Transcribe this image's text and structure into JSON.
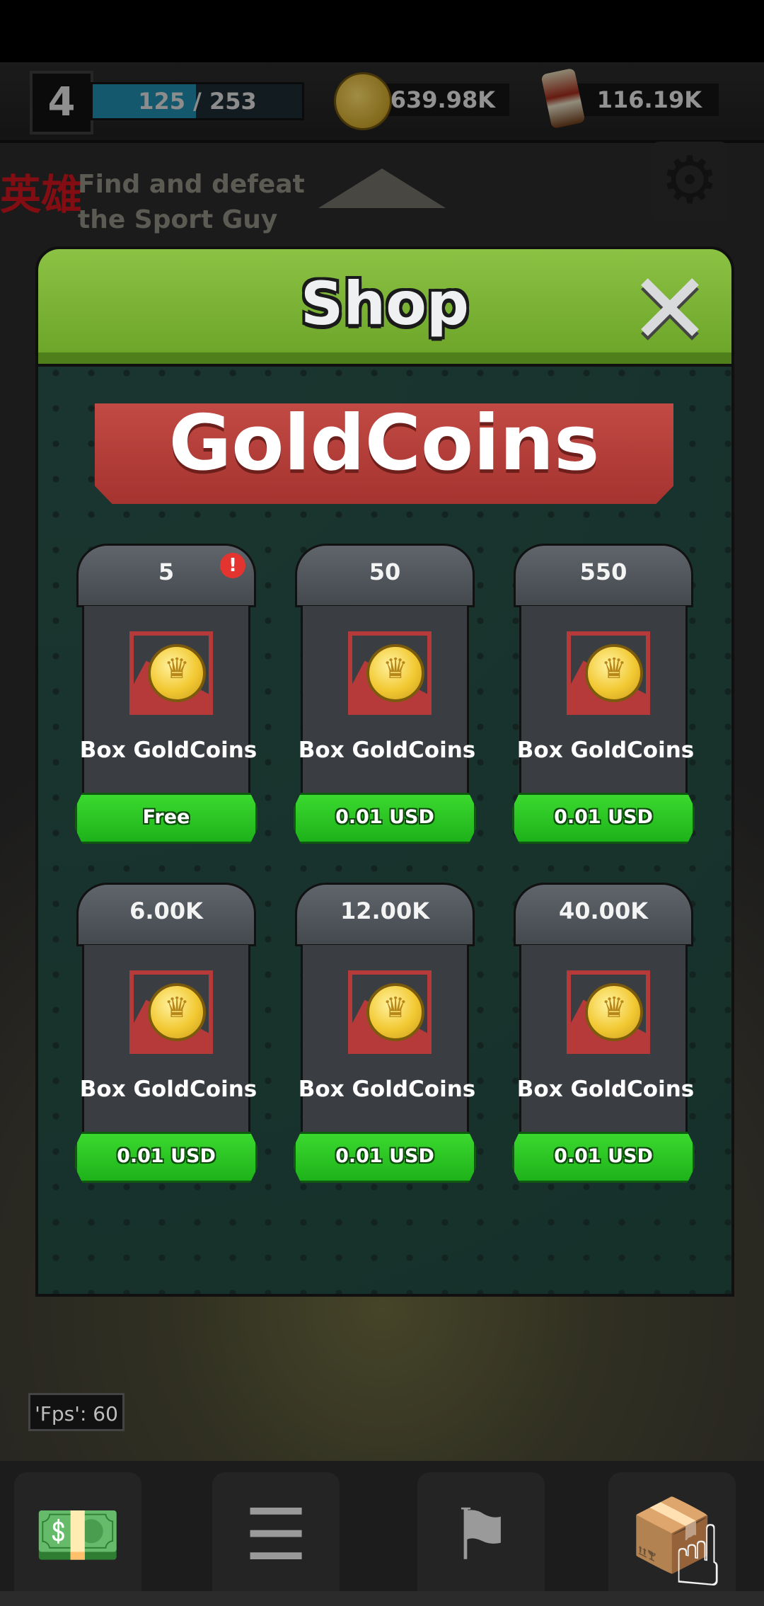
{
  "hud": {
    "level": "4",
    "xp_text": "125 / 253",
    "xp_progress": 0.494,
    "coins": "639.98K",
    "cans": "116.19K"
  },
  "quest": {
    "badge": "英雄",
    "text": "Find and defeat the Sport Guy"
  },
  "shop": {
    "title": "Shop",
    "close_symbol": "✕",
    "banner": "GoldCoins",
    "items": [
      {
        "amount": "5",
        "label": "Box GoldCoins",
        "price": "Free",
        "alert": "!"
      },
      {
        "amount": "50",
        "label": "Box GoldCoins",
        "price": "0.01 USD"
      },
      {
        "amount": "550",
        "label": "Box GoldCoins",
        "price": "0.01 USD"
      },
      {
        "amount": "6.00K",
        "label": "Box GoldCoins",
        "price": "0.01 USD"
      },
      {
        "amount": "12.00K",
        "label": "Box GoldCoins",
        "price": "0.01 USD"
      },
      {
        "amount": "40.00K",
        "label": "Box GoldCoins",
        "price": "0.01 USD"
      }
    ]
  },
  "debug": {
    "fps": "'Fps': 60"
  },
  "icons": {
    "gear": "gear-icon",
    "coin": "gold-coin-icon",
    "can": "soda-can-icon",
    "money": "money-stack-icon",
    "list": "notepad-icon",
    "flag": "flag-icon",
    "hand": "pointing-hand-icon"
  },
  "colors": {
    "header_green": "#7ab536",
    "banner_red": "#b23c38",
    "buy_green": "#2cc524",
    "panel_dark": "#18302c",
    "card_gray": "#3a3e43"
  }
}
